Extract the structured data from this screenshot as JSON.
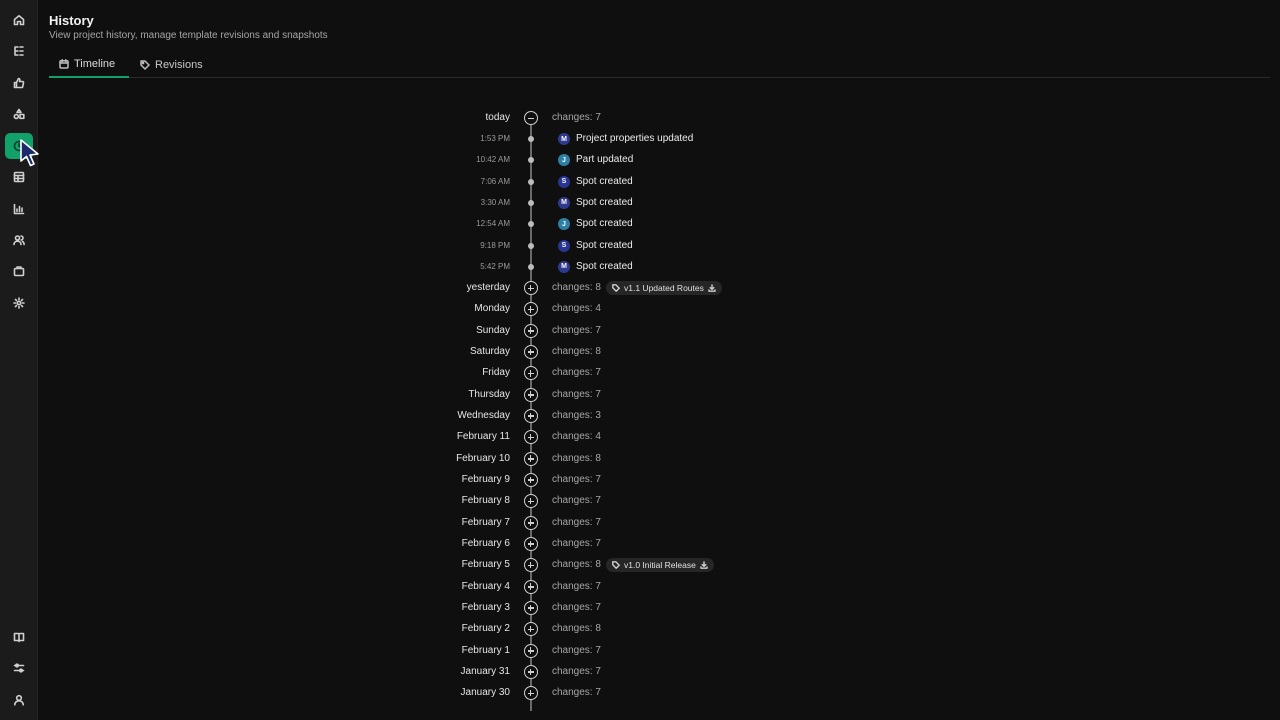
{
  "header": {
    "title": "History",
    "subtitle": "View project history, manage template revisions and snapshots"
  },
  "tabs": [
    {
      "label": "Timeline",
      "icon": "calendar-icon",
      "active": true
    },
    {
      "label": "Revisions",
      "icon": "tag-icon",
      "active": false
    }
  ],
  "sidebar": {
    "top_icons": [
      "home-icon",
      "tree-icon",
      "thumbs-up-icon",
      "shapes-icon",
      "history-icon",
      "table-icon",
      "chart-icon",
      "users-icon",
      "briefcase-icon",
      "gear-icon"
    ],
    "bottom_icons": [
      "book-icon",
      "sliders-icon",
      "user-icon"
    ],
    "active": "history-icon"
  },
  "colors": {
    "accent": "#12a06b",
    "avatar_m": "#2f3a8f",
    "avatar_j": "#2e7fa6",
    "avatar_s": "#283593"
  },
  "timeline": {
    "today": {
      "label": "today",
      "changes": "changes: 7",
      "events": [
        {
          "time": "1:53 PM",
          "initial": "M",
          "text": "Project properties updated"
        },
        {
          "time": "10:42 AM",
          "initial": "J",
          "text": "Part updated"
        },
        {
          "time": "7:06 AM",
          "initial": "S",
          "text": "Spot created"
        },
        {
          "time": "3:30 AM",
          "initial": "M",
          "text": "Spot created"
        },
        {
          "time": "12:54 AM",
          "initial": "J",
          "text": "Spot created"
        },
        {
          "time": "9:18 PM",
          "initial": "S",
          "text": "Spot created"
        },
        {
          "time": "5:42 PM",
          "initial": "M",
          "text": "Spot created"
        }
      ]
    },
    "days": [
      {
        "label": "yesterday",
        "changes": "changes: 8",
        "badge": "v1.1 Updated Routes"
      },
      {
        "label": "Monday",
        "changes": "changes: 4"
      },
      {
        "label": "Sunday",
        "changes": "changes: 7"
      },
      {
        "label": "Saturday",
        "changes": "changes: 8"
      },
      {
        "label": "Friday",
        "changes": "changes: 7"
      },
      {
        "label": "Thursday",
        "changes": "changes: 7"
      },
      {
        "label": "Wednesday",
        "changes": "changes: 3"
      },
      {
        "label": "February 11",
        "changes": "changes: 4"
      },
      {
        "label": "February 10",
        "changes": "changes: 8"
      },
      {
        "label": "February 9",
        "changes": "changes: 7"
      },
      {
        "label": "February 8",
        "changes": "changes: 7"
      },
      {
        "label": "February 7",
        "changes": "changes: 7"
      },
      {
        "label": "February 6",
        "changes": "changes: 7"
      },
      {
        "label": "February 5",
        "changes": "changes: 8",
        "badge": "v1.0 Initial Release"
      },
      {
        "label": "February 4",
        "changes": "changes: 7"
      },
      {
        "label": "February 3",
        "changes": "changes: 7"
      },
      {
        "label": "February 2",
        "changes": "changes: 8"
      },
      {
        "label": "February 1",
        "changes": "changes: 7"
      },
      {
        "label": "January 31",
        "changes": "changes: 7"
      },
      {
        "label": "January 30",
        "changes": "changes: 7"
      }
    ]
  }
}
